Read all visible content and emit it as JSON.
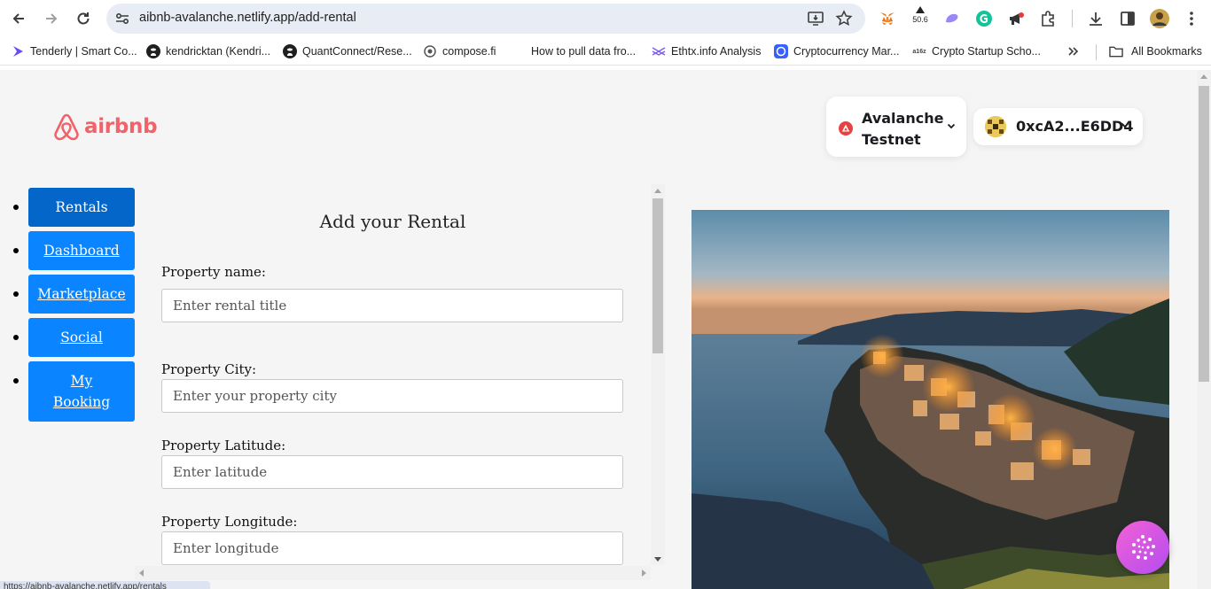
{
  "browser": {
    "url": "aibnb-avalanche.netlify.app/add-rental",
    "extension_badge": "50.6",
    "bookmarks": [
      {
        "label": "Tenderly | Smart Co...",
        "icon": "tenderly-icon"
      },
      {
        "label": "kendricktan (Kendri...",
        "icon": "github-icon"
      },
      {
        "label": "QuantConnect/Rese...",
        "icon": "github-icon"
      },
      {
        "label": "compose.fi",
        "icon": "compose-icon"
      },
      {
        "label": "How to pull data fro...",
        "icon": "blank-icon"
      },
      {
        "label": "Ethtx.info Analysis",
        "icon": "ethtx-icon"
      },
      {
        "label": "Cryptocurrency Mar...",
        "icon": "coinmarketcap-icon"
      },
      {
        "label": "Crypto Startup Scho...",
        "icon": "a16z-icon"
      }
    ],
    "all_bookmarks_label": "All Bookmarks",
    "status_url": "https://aibnb-avalanche.netlify.app/rentals"
  },
  "header": {
    "logo_text": "airbnb",
    "network_label": "Avalanche Testnet",
    "account_label": "0xcA2...E6DD4"
  },
  "sidebar": {
    "items": [
      {
        "label": "Rentals",
        "active": true
      },
      {
        "label": "Dashboard",
        "active": false
      },
      {
        "label": "Marketplace",
        "active": false
      },
      {
        "label": "Social",
        "active": false
      },
      {
        "label": "My Booking",
        "active": false
      }
    ]
  },
  "form": {
    "title": "Add your Rental",
    "fields": [
      {
        "label": "Property name:",
        "placeholder": "Enter rental title"
      },
      {
        "label": "Property City:",
        "placeholder": "Enter your property city"
      },
      {
        "label": "Property Latitude:",
        "placeholder": "Enter latitude"
      },
      {
        "label": "Property Longitude:",
        "placeholder": "Enter longitude"
      }
    ]
  },
  "colors": {
    "brand": "#f0636a",
    "nav_button": "#0a84ff",
    "nav_button_active": "#0466c8",
    "avalanche_red": "#e84142"
  }
}
